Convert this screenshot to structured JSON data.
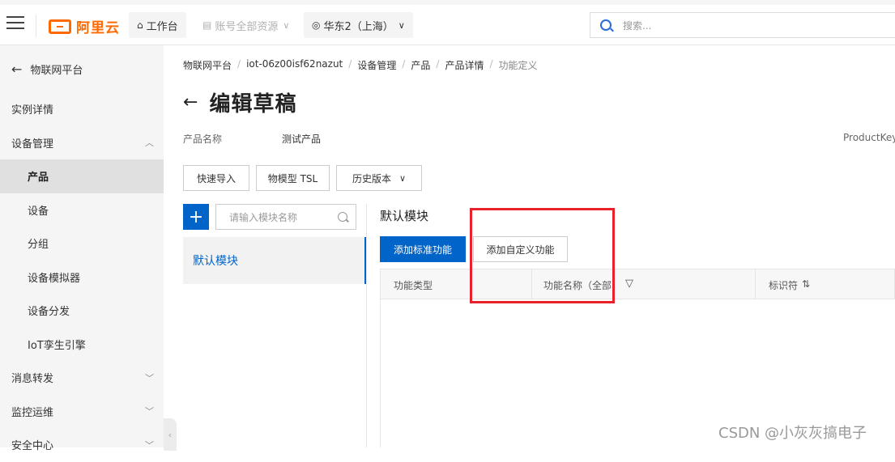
{
  "topbar": {
    "logo_text": "阿里云",
    "workbench": "工作台",
    "all_resources": "账号全部资源",
    "region": "华东2（上海）",
    "search_placeholder": "搜索..."
  },
  "sidebar": {
    "back_label": "物联网平台",
    "items": [
      {
        "label": "实例详情"
      },
      {
        "label": "设备管理"
      },
      {
        "label": "产品"
      },
      {
        "label": "设备"
      },
      {
        "label": "分组"
      },
      {
        "label": "设备模拟器"
      },
      {
        "label": "设备分发"
      },
      {
        "label": "IoT孪生引擎"
      },
      {
        "label": "消息转发"
      },
      {
        "label": "监控运维"
      },
      {
        "label": "安全中心"
      }
    ]
  },
  "breadcrumb": [
    "物联网平台",
    "iot-06z00isf62nazut",
    "设备管理",
    "产品",
    "产品详情",
    "功能定义"
  ],
  "page": {
    "title": "编辑草稿",
    "product_name_label": "产品名称",
    "product_name_value": "测试产品",
    "product_key_label": "ProductKey"
  },
  "toolbar": {
    "quick_import": "快速导入",
    "tsl": "物模型 TSL",
    "history": "历史版本"
  },
  "modules": {
    "add_symbol": "+",
    "search_placeholder": "请输入模块名称",
    "items": [
      {
        "label": "默认模块"
      }
    ]
  },
  "content": {
    "section_title": "默认模块",
    "add_standard": "添加标准功能",
    "add_custom": "添加自定义功能",
    "columns": [
      "功能类型",
      "功能名称（全部",
      "标识符"
    ]
  },
  "watermark": "CSDN @小灰灰搞电子",
  "colors": {
    "brand": "#ff6a00",
    "primary": "#0064c8",
    "highlight": "#e8222a"
  }
}
